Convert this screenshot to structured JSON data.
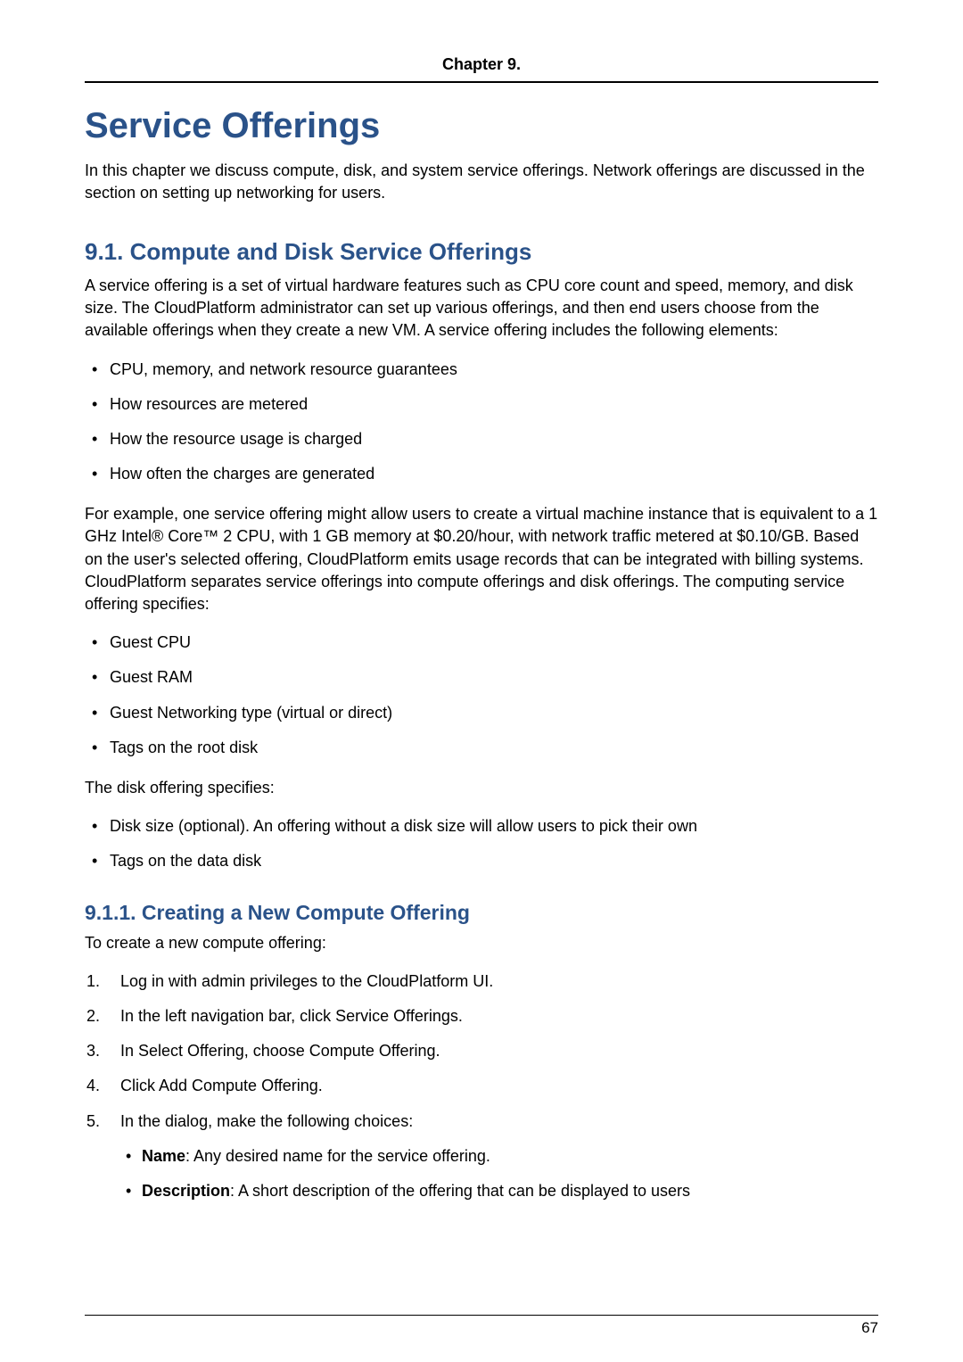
{
  "chapter_header": "Chapter 9.",
  "title": "Service Offerings",
  "intro": "In this chapter we discuss compute, disk, and system service offerings. Network offerings are discussed in the section on setting up networking for users.",
  "section_9_1": {
    "heading": "9.1. Compute and Disk Service Offerings",
    "p1": "A service offering is a set of virtual hardware features such as CPU core count and speed, memory, and disk size. The CloudPlatform administrator can set up various offerings, and then end users choose from the available offerings when they create a new VM. A service offering includes the following elements:",
    "list1": [
      "CPU, memory, and network resource guarantees",
      "How resources are metered",
      "How the resource usage is charged",
      "How often the charges are generated"
    ],
    "p2": "For example, one service offering might allow users to create a virtual machine instance that is equivalent to a 1 GHz Intel® Core™ 2 CPU, with 1 GB memory at $0.20/hour, with network traffic metered at $0.10/GB. Based on the user's selected offering, CloudPlatform emits usage records that can be integrated with billing systems. CloudPlatform separates service offerings into compute offerings and disk offerings. The computing service offering specifies:",
    "list2": [
      "Guest CPU",
      "Guest RAM",
      "Guest Networking type (virtual or direct)",
      "Tags on the root disk"
    ],
    "p3": "The disk offering specifies:",
    "list3": [
      "Disk size (optional). An offering without a disk size will allow users to pick their own",
      "Tags on the data disk"
    ]
  },
  "section_9_1_1": {
    "heading": "9.1.1. Creating a New Compute Offering",
    "p1": "To create a new compute offering:",
    "steps": [
      "Log in with admin privileges to the CloudPlatform UI.",
      "In the left navigation bar, click Service Offerings.",
      "In Select Offering, choose Compute Offering.",
      "Click Add Compute Offering.",
      "In the dialog, make the following choices:"
    ],
    "sub": [
      {
        "label": "Name",
        "text": ": Any desired name for the service offering."
      },
      {
        "label": "Description",
        "text": ": A short description of the offering that can be displayed to users"
      }
    ]
  },
  "page_number": "67"
}
